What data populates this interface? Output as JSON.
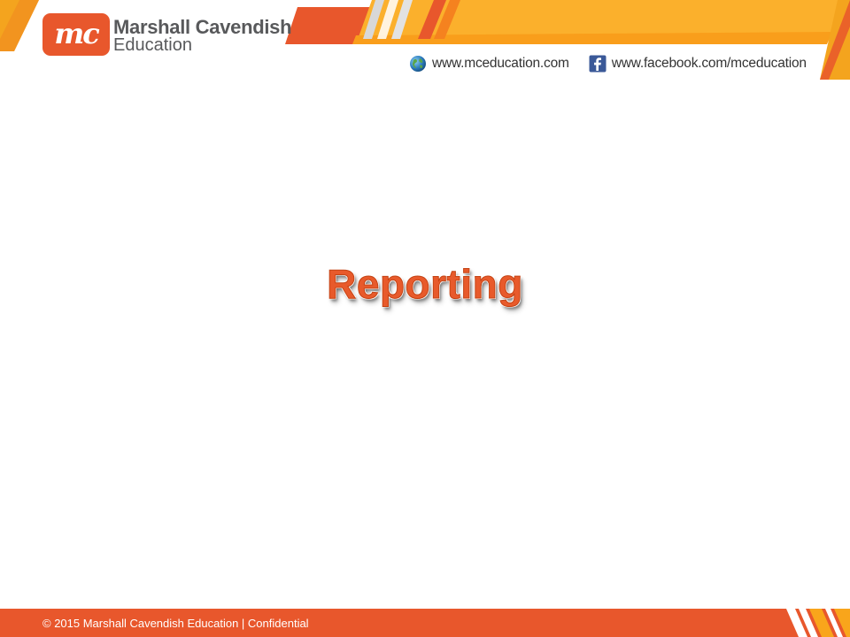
{
  "brand": {
    "name": "Marshall Cavendish",
    "subtitle": "Education",
    "monogram": "mc",
    "primary_color": "#e8572c",
    "accent_color": "#f9a51b",
    "text_color": "#58595b"
  },
  "header": {
    "links": [
      {
        "icon": "globe-icon",
        "text": "www.mceducation.com"
      },
      {
        "icon": "facebook-icon",
        "text": "www.facebook.com/mceducation"
      }
    ]
  },
  "slide": {
    "title": "Reporting",
    "title_color": "#e85a2b"
  },
  "footer": {
    "text": "© 2015 Marshall Cavendish Education | Confidential",
    "background_color": "#e8572c"
  }
}
